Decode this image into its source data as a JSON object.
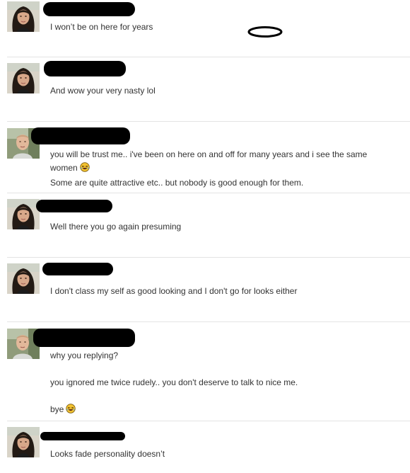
{
  "messages": [
    {
      "sender": "her",
      "lines": [
        "I won’t be on here for years"
      ]
    },
    {
      "sender": "her",
      "lines": [
        "And wow your very nasty lol"
      ]
    },
    {
      "sender": "him",
      "lines": [
        "you will be trust me.. i've been on here on and off for many years and i see the same women",
        "Some are quite attractive etc.. but nobody is good enough for them."
      ],
      "emoji": "laughing-face-icon"
    },
    {
      "sender": "her",
      "lines": [
        "Well there you go again presuming"
      ]
    },
    {
      "sender": "her",
      "lines": [
        "I don't class my self as good looking and I don't go for looks either"
      ]
    },
    {
      "sender": "him",
      "lines": [
        "why you replying?",
        "you ignored me twice rudely.. you don't deserve to talk to nice me.",
        "bye"
      ],
      "emoji": "laughing-face-icon"
    },
    {
      "sender": "her",
      "lines": [
        "Looks fade personality doesn’t"
      ]
    }
  ],
  "colors": {
    "divider": "#e4e4e4",
    "text": "#333333",
    "redaction": "#000000",
    "emoji": "#f2c230"
  }
}
